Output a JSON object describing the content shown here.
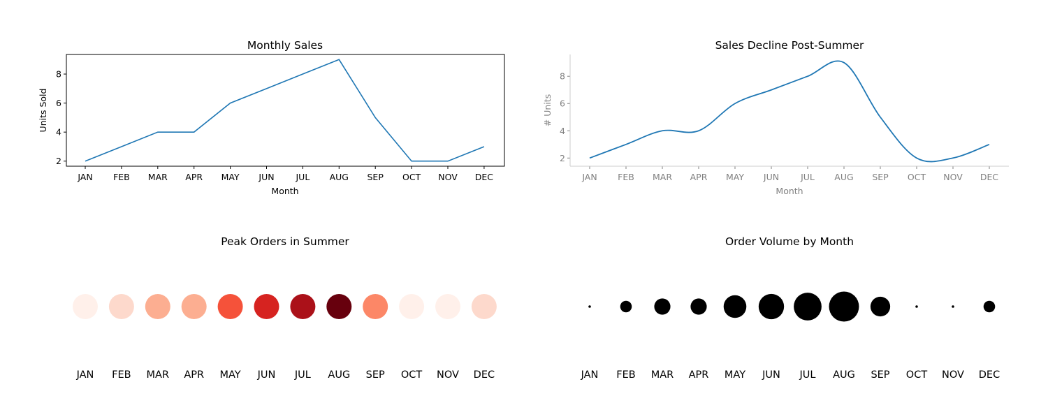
{
  "chart_data": [
    {
      "type": "line",
      "title": "Monthly Sales",
      "xlabel": "Month",
      "ylabel": "Units Sold",
      "categories": [
        "JAN",
        "FEB",
        "MAR",
        "APR",
        "MAY",
        "JUN",
        "JUL",
        "AUG",
        "SEP",
        "OCT",
        "NOV",
        "DEC"
      ],
      "values": [
        2,
        3,
        4,
        4,
        6,
        7,
        8,
        9,
        5,
        2,
        2,
        3
      ],
      "yticks": [
        2,
        4,
        6,
        8
      ],
      "ylim": [
        1.65,
        9.35
      ],
      "line_color": "#1f77b4",
      "smooth": false,
      "spines": "all"
    },
    {
      "type": "line",
      "title": "Sales Decline Post-Summer",
      "xlabel": "Month",
      "ylabel": "# Units",
      "categories": [
        "JAN",
        "FEB",
        "MAR",
        "APR",
        "MAY",
        "JUN",
        "JUL",
        "AUG",
        "SEP",
        "OCT",
        "NOV",
        "DEC"
      ],
      "values": [
        2,
        3,
        4,
        4,
        6,
        7,
        8,
        9,
        5,
        2,
        2,
        3
      ],
      "yticks": [
        2,
        4,
        6,
        8
      ],
      "ylim": [
        1.4,
        9.6
      ],
      "line_color": "#1f77b4",
      "smooth": true,
      "spines": "left-bottom",
      "axis_color": "#808080"
    },
    {
      "type": "scatter",
      "title": "Peak Orders in Summer",
      "categories": [
        "JAN",
        "FEB",
        "MAR",
        "APR",
        "MAY",
        "JUN",
        "JUL",
        "AUG",
        "SEP",
        "OCT",
        "NOV",
        "DEC"
      ],
      "values": [
        2,
        3,
        4,
        4,
        6,
        7,
        8,
        9,
        5,
        2,
        2,
        3
      ],
      "encoding": "color (Reds colormap)",
      "colors": [
        "#fff0ea",
        "#fdd9cc",
        "#fcae91",
        "#fcae91",
        "#f5523a",
        "#d62320",
        "#ab1119",
        "#67000d",
        "#fc8767",
        "#fff0ea",
        "#fff0ea",
        "#fdd9cc"
      ]
    },
    {
      "type": "scatter",
      "title": "Order Volume by Month",
      "categories": [
        "JAN",
        "FEB",
        "MAR",
        "APR",
        "MAY",
        "JUN",
        "JUL",
        "AUG",
        "SEP",
        "OCT",
        "NOV",
        "DEC"
      ],
      "values": [
        2,
        3,
        4,
        4,
        6,
        7,
        8,
        9,
        5,
        2,
        2,
        3
      ],
      "encoding": "size",
      "color": "#000000"
    }
  ]
}
